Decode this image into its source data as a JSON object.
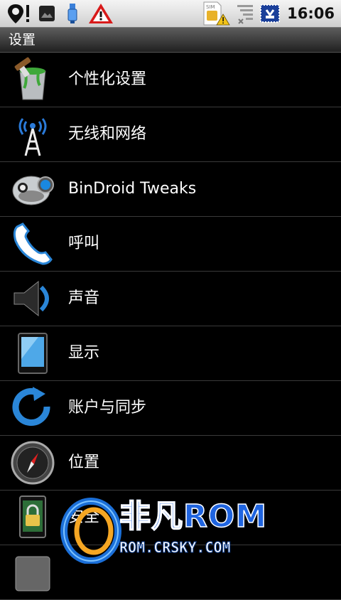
{
  "status_bar": {
    "time": "16:06",
    "sim_label": "SIM",
    "icons": [
      "location-pin-icon",
      "photo-icon",
      "usb-icon",
      "warning-icon",
      "sim-warning-icon",
      "signal-icon",
      "debug-icon"
    ]
  },
  "header": {
    "title": "设置"
  },
  "settings": {
    "items": [
      {
        "label": "个性化设置",
        "icon": "paint-bucket-icon"
      },
      {
        "label": "无线和网络",
        "icon": "wireless-tower-icon"
      },
      {
        "label": "BinDroid Tweaks",
        "icon": "bindroid-icon"
      },
      {
        "label": "呼叫",
        "icon": "phone-icon"
      },
      {
        "label": "声音",
        "icon": "speaker-icon"
      },
      {
        "label": "显示",
        "icon": "display-icon"
      },
      {
        "label": "账户与同步",
        "icon": "sync-icon"
      },
      {
        "label": "位置",
        "icon": "compass-icon"
      },
      {
        "label": "安全",
        "icon": "lock-icon"
      },
      {
        "label": "",
        "icon": "app-icon"
      }
    ]
  },
  "watermark": {
    "brand": "非凡ROM",
    "url": "ROM.CRSKY.COM"
  }
}
